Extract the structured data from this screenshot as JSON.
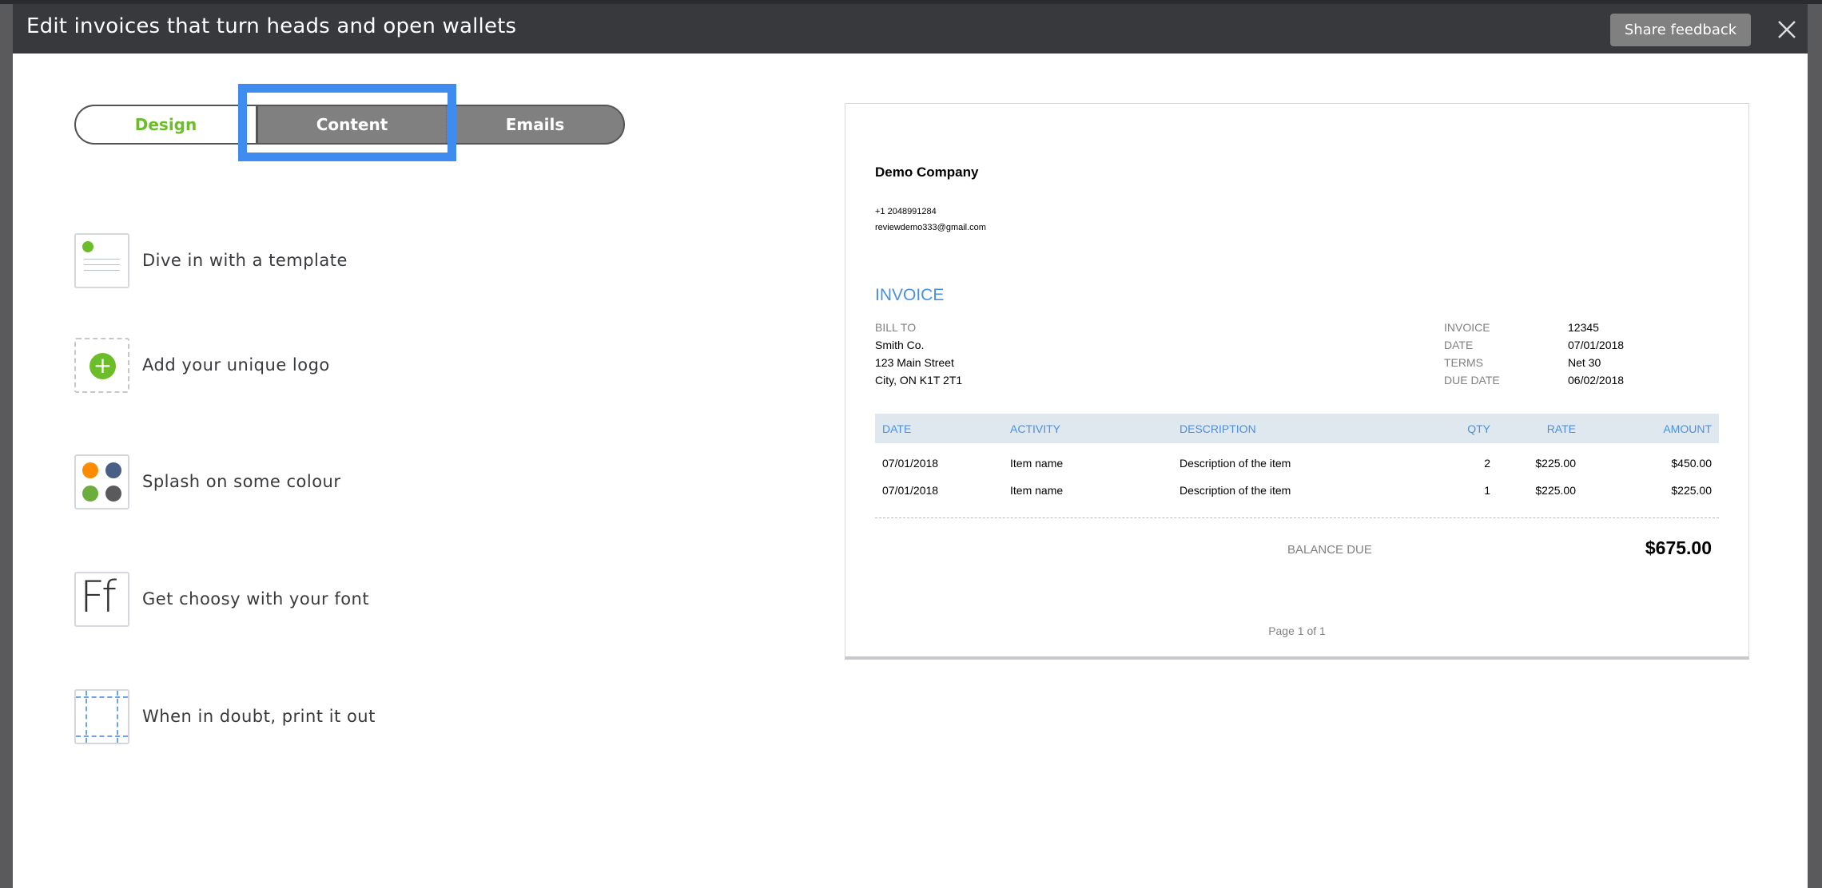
{
  "header": {
    "title": "Edit invoices that turn heads and open wallets",
    "share_feedback": "Share feedback",
    "close_icon": "close-icon"
  },
  "tabs": [
    {
      "label": "Design",
      "active": true
    },
    {
      "label": "Content",
      "active": false,
      "highlighted": true
    },
    {
      "label": "Emails",
      "active": false
    }
  ],
  "features": [
    {
      "label": "Dive in with a template",
      "icon": "template-icon"
    },
    {
      "label": "Add your unique logo",
      "icon": "add-logo-icon"
    },
    {
      "label": "Splash on some colour",
      "icon": "colour-palette-icon"
    },
    {
      "label": "Get choosy with your font",
      "icon": "font-icon"
    },
    {
      "label": "When in doubt, print it out",
      "icon": "print-margins-icon"
    }
  ],
  "colors": {
    "accent_green": "#6cbd2a",
    "highlight_blue": "#3f8cf0",
    "invoice_blue": "#4a90e2",
    "palette": [
      "#ff8c00",
      "#4a5f85",
      "#6cae3e",
      "#5a5a5c"
    ]
  },
  "invoice": {
    "company": "Demo Company",
    "phone": "+1 2048991284",
    "email": "reviewdemo333@gmail.com",
    "title": "INVOICE",
    "bill_to": {
      "label": "BILL TO",
      "name": "Smith Co.",
      "street": "123 Main Street",
      "city": "City, ON K1T 2T1"
    },
    "meta": [
      {
        "label": "INVOICE",
        "value": "12345"
      },
      {
        "label": "DATE",
        "value": "07/01/2018"
      },
      {
        "label": "TERMS",
        "value": "Net 30"
      },
      {
        "label": "DUE DATE",
        "value": "06/02/2018"
      }
    ],
    "columns": [
      "DATE",
      "ACTIVITY",
      "DESCRIPTION",
      "QTY",
      "RATE",
      "AMOUNT"
    ],
    "rows": [
      [
        "07/01/2018",
        "Item name",
        "Description of the item",
        "2",
        "$225.00",
        "$450.00"
      ],
      [
        "07/01/2018",
        "Item name",
        "Description of the item",
        "1",
        "$225.00",
        "$225.00"
      ]
    ],
    "balance_label": "BALANCE DUE",
    "balance_value": "$675.00",
    "page": "Page 1 of 1"
  }
}
